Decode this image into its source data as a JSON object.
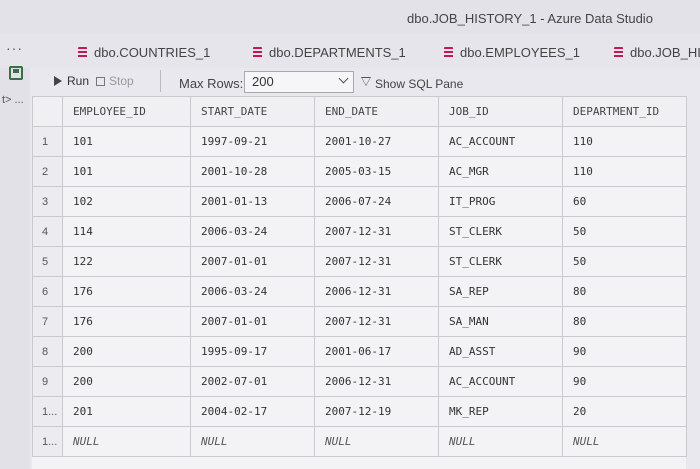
{
  "window": {
    "title": "dbo.JOB_HISTORY_1 - Azure Data Studio"
  },
  "tabs": [
    {
      "label": "dbo.COUNTRIES_1",
      "icon": "table-icon"
    },
    {
      "label": "dbo.DEPARTMENTS_1",
      "icon": "table-icon"
    },
    {
      "label": "dbo.EMPLOYEES_1",
      "icon": "table-icon"
    },
    {
      "label": "dbo.JOB_HI",
      "icon": "table-icon"
    }
  ],
  "more_label": "···",
  "rail": {
    "label": "t> ..."
  },
  "toolbar": {
    "run_label": "Run",
    "stop_label": "Stop",
    "max_rows_label": "Max Rows:",
    "max_rows_value": "200",
    "show_sql_label": "Show SQL Pane"
  },
  "grid": {
    "columns": [
      "EMPLOYEE_ID",
      "START_DATE",
      "END_DATE",
      "JOB_ID",
      "DEPARTMENT_ID"
    ],
    "rows": [
      {
        "num": "1",
        "cells": [
          "101",
          "1997-09-21",
          "2001-10-27",
          "AC_ACCOUNT",
          "110"
        ]
      },
      {
        "num": "2",
        "cells": [
          "101",
          "2001-10-28",
          "2005-03-15",
          "AC_MGR",
          "110"
        ]
      },
      {
        "num": "3",
        "cells": [
          "102",
          "2001-01-13",
          "2006-07-24",
          "IT_PROG",
          "60"
        ]
      },
      {
        "num": "4",
        "cells": [
          "114",
          "2006-03-24",
          "2007-12-31",
          "ST_CLERK",
          "50"
        ]
      },
      {
        "num": "5",
        "cells": [
          "122",
          "2007-01-01",
          "2007-12-31",
          "ST_CLERK",
          "50"
        ]
      },
      {
        "num": "6",
        "cells": [
          "176",
          "2006-03-24",
          "2006-12-31",
          "SA_REP",
          "80"
        ]
      },
      {
        "num": "7",
        "cells": [
          "176",
          "2007-01-01",
          "2007-12-31",
          "SA_MAN",
          "80"
        ]
      },
      {
        "num": "8",
        "cells": [
          "200",
          "1995-09-17",
          "2001-06-17",
          "AD_ASST",
          "90"
        ]
      },
      {
        "num": "9",
        "cells": [
          "200",
          "2002-07-01",
          "2006-12-31",
          "AC_ACCOUNT",
          "90"
        ]
      },
      {
        "num": "1...",
        "cells": [
          "201",
          "2004-02-17",
          "2007-12-19",
          "MK_REP",
          "20"
        ]
      },
      {
        "num": "1...",
        "cells": [
          "NULL",
          "NULL",
          "NULL",
          "NULL",
          "NULL"
        ]
      }
    ]
  }
}
